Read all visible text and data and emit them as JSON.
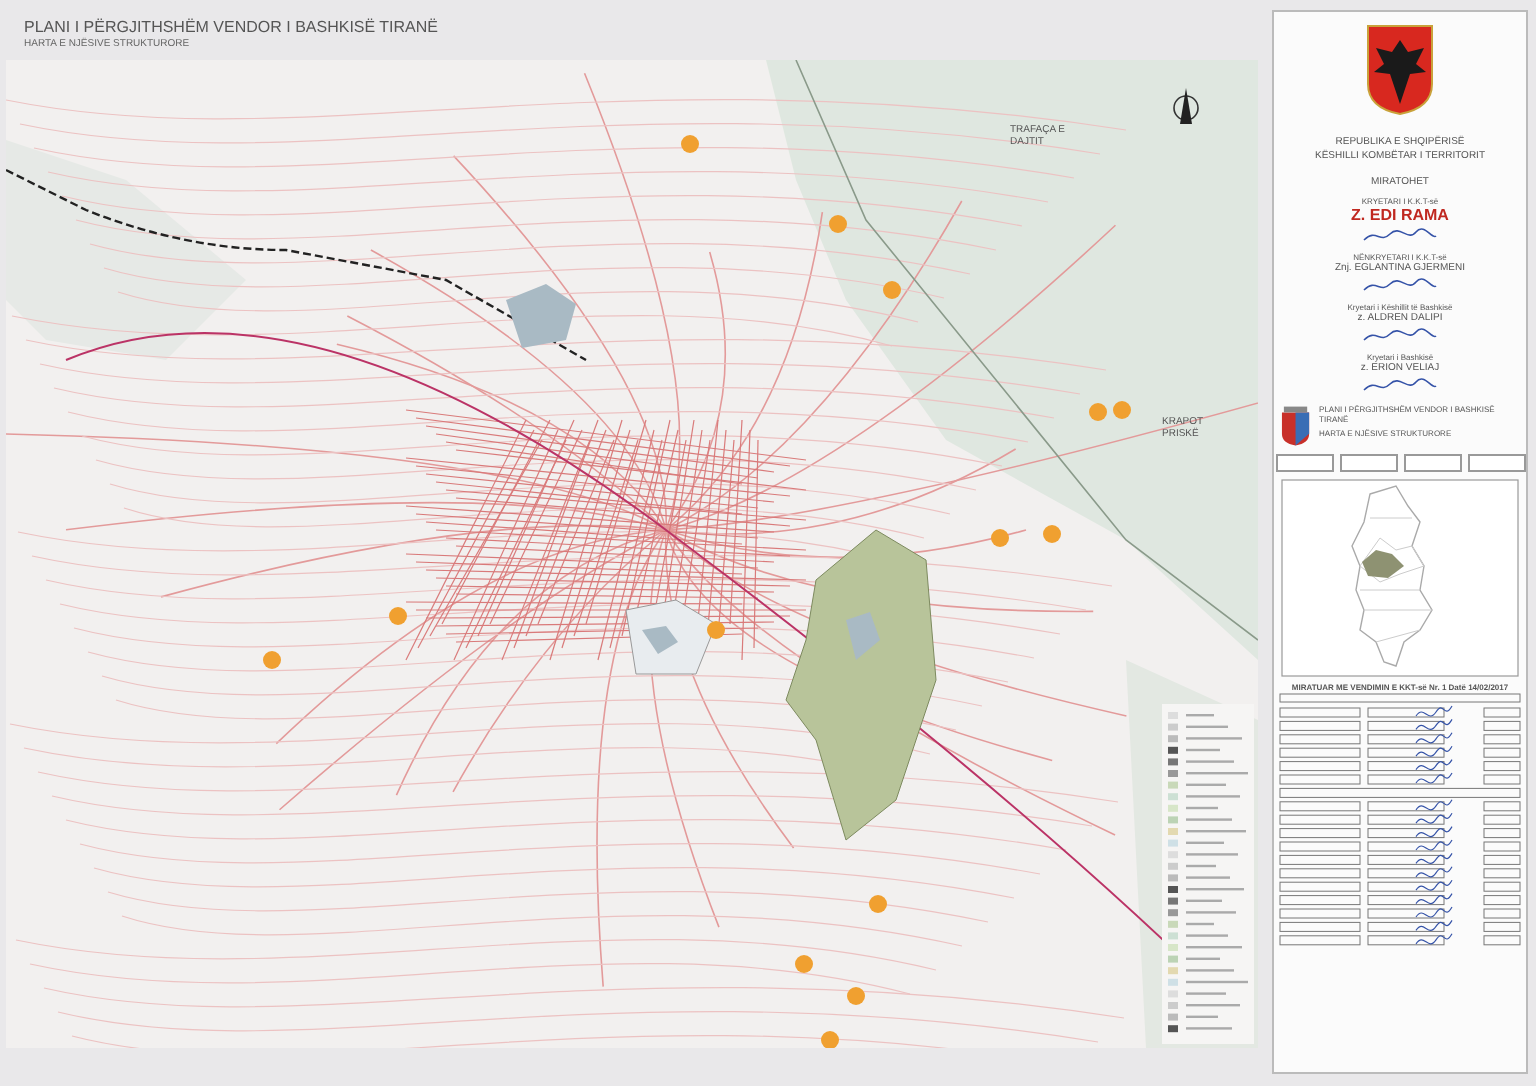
{
  "title": "PLANI I PËRGJITHSHËM VENDOR I BASHKISË TIRANË",
  "subtitle": "HARTA E NJËSIVE STRUKTURORE",
  "map": {
    "labels": [
      {
        "text": "TRAFAÇA E DAJTIT"
      },
      {
        "text": "KRAPOT PRISKË"
      }
    ]
  },
  "panel": {
    "authority": [
      "REPUBLIKA E SHQIPËRISË",
      "KËSHILLI KOMBËTAR I TERRITORIT"
    ],
    "heading": "MIRATOHET",
    "signatories": [
      {
        "role": "KRYETARI I K.K.T-së",
        "name": "Z. EDI RAMA",
        "emphasis": true
      },
      {
        "role": "NËNKRYETARI I K.K.T-së",
        "name": "Znj. EGLANTINA GJERMENI",
        "emphasis": false
      },
      {
        "role": "Kryetari i Këshillit të Bashkisë",
        "name": "z. ALDREN DALIPI",
        "emphasis": false
      },
      {
        "role": "Kryetari i Bashkisë",
        "name": "z. ERION VELIAJ",
        "emphasis": false
      }
    ],
    "plan_header": {
      "title": "PLANI I PËRGJITHSHËM VENDOR I BASHKISË TIRANË",
      "subtitle": "HARTA E NJËSIVE STRUKTURORE"
    },
    "approval_table": {
      "title": "MIRATUAR ME VENDIMIN E KKT-së Nr. 1 Datë 14/02/2017"
    }
  }
}
